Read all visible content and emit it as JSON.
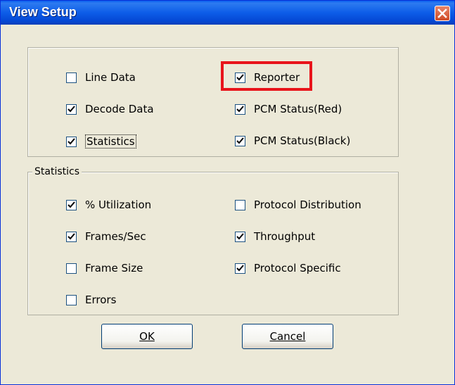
{
  "dialog": {
    "title": "View Setup"
  },
  "views": {
    "line_data": {
      "label": "Line Data",
      "checked": false
    },
    "decode_data": {
      "label": "Decode Data",
      "checked": true
    },
    "statistics": {
      "label": "Statistics",
      "checked": true
    },
    "reporter": {
      "label": "Reporter",
      "checked": true
    },
    "pcm_red": {
      "label": "PCM Status(Red)",
      "checked": true
    },
    "pcm_black": {
      "label": "PCM Status(Black)",
      "checked": true
    }
  },
  "statistics_group": {
    "legend": "Statistics",
    "utilization": {
      "label": "% Utilization",
      "checked": true
    },
    "frames_sec": {
      "label": "Frames/Sec",
      "checked": true
    },
    "frame_size": {
      "label": "Frame Size",
      "checked": false
    },
    "errors": {
      "label": "Errors",
      "checked": false
    },
    "protocol_distribution": {
      "label": "Protocol Distribution",
      "checked": false
    },
    "throughput": {
      "label": "Throughput",
      "checked": true
    },
    "protocol_specific": {
      "label": "Protocol Specific",
      "checked": true
    }
  },
  "buttons": {
    "ok": "OK",
    "cancel": "Cancel"
  },
  "colors": {
    "title_bar": "#0A5EEF",
    "highlight": "#E8141B",
    "dialog_bg": "#ECE9D8"
  }
}
